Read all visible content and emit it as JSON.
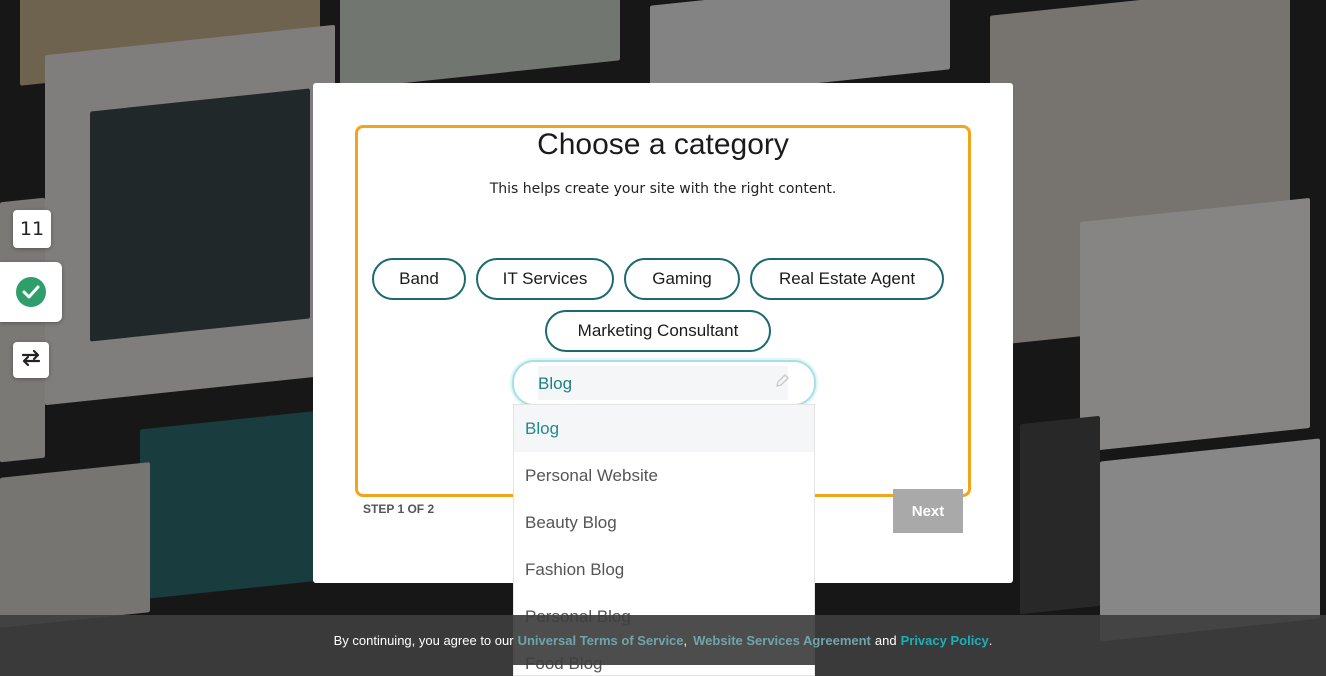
{
  "tools": {
    "number": "11"
  },
  "modal": {
    "title": "Choose a category",
    "subtitle": "This helps create your site with the right content.",
    "chips": [
      "Band",
      "IT Services",
      "Gaming",
      "Real Estate Agent",
      "Marketing Consultant"
    ],
    "combo_value": "Blog",
    "step_label": "STEP 1 OF 2",
    "next_label": "Next"
  },
  "dropdown": {
    "options": [
      "Blog",
      "Personal Website",
      "Beauty Blog",
      "Fashion Blog",
      "Personal Blog",
      "Food Blog"
    ],
    "selected": "Blog"
  },
  "footer": {
    "prefix": "By continuing, you agree to our",
    "terms_link": "Universal Terms of Service",
    "comma": ",",
    "agreement_link": "Website Services Agreement",
    "and": "and",
    "privacy_link": "Privacy Policy",
    "period": "."
  },
  "colors": {
    "accent": "#1b6a70",
    "highlight": "#f2a51a",
    "link": "#1bb0b8",
    "check": "#2e9e6b"
  },
  "icons": [
    "check-icon",
    "swap-icon",
    "pencil-icon"
  ]
}
